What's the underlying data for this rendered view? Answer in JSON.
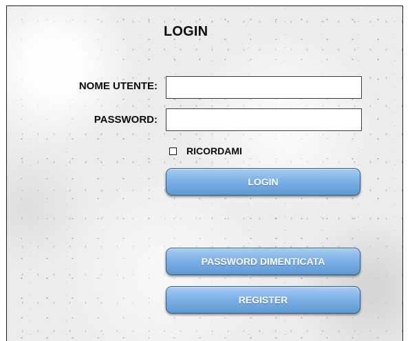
{
  "login_form": {
    "title": "LOGIN",
    "username": {
      "label": "NOME UTENTE:",
      "value": "",
      "placeholder": ""
    },
    "password": {
      "label": "PASSWORD:",
      "value": "",
      "placeholder": ""
    },
    "remember": {
      "label": "RICORDAMI",
      "checked": false
    },
    "buttons": {
      "login": "LOGIN",
      "forgot_password": "PASSWORD DIMENTICATA",
      "register": "REGISTER"
    }
  },
  "colors": {
    "button_top": "#a8cdf2",
    "button_bottom": "#5f99d4",
    "button_border": "#2e5f8f",
    "text": "#0a0a0a",
    "background": "#ececec"
  }
}
